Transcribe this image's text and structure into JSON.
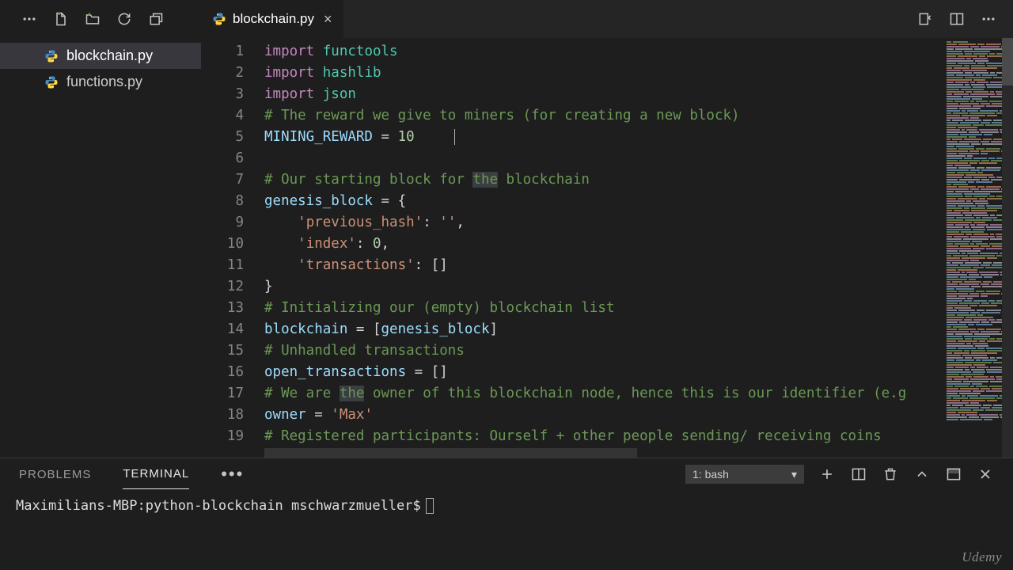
{
  "tab": {
    "filename": "blockchain.py"
  },
  "sidebar": {
    "files": [
      {
        "name": "blockchain.py",
        "active": true
      },
      {
        "name": "functions.py",
        "active": false
      }
    ]
  },
  "editor": {
    "lines": [
      {
        "n": 1,
        "tokens": [
          [
            "kw",
            "import"
          ],
          [
            "w",
            " "
          ],
          [
            "mod",
            "functools"
          ]
        ]
      },
      {
        "n": 2,
        "tokens": [
          [
            "kw",
            "import"
          ],
          [
            "w",
            " "
          ],
          [
            "mod",
            "hashlib"
          ]
        ]
      },
      {
        "n": 3,
        "tokens": [
          [
            "kw",
            "import"
          ],
          [
            "w",
            " "
          ],
          [
            "mod",
            "json"
          ]
        ]
      },
      {
        "n": 4,
        "tokens": [
          [
            "com",
            "# The reward we give to miners (for creating a new block)"
          ]
        ]
      },
      {
        "n": 5,
        "tokens": [
          [
            "var",
            "MINING_REWARD"
          ],
          [
            "w",
            " = "
          ],
          [
            "num",
            "10"
          ]
        ],
        "caret": true
      },
      {
        "n": 6,
        "tokens": []
      },
      {
        "n": 7,
        "tokens": [
          [
            "com",
            "# Our starting block for "
          ],
          [
            "comhl",
            "the"
          ],
          [
            "com",
            " blockchain"
          ]
        ]
      },
      {
        "n": 8,
        "tokens": [
          [
            "var",
            "genesis_block"
          ],
          [
            "w",
            " = {"
          ]
        ]
      },
      {
        "n": 9,
        "tokens": [
          [
            "w",
            "    "
          ],
          [
            "str",
            "'previous_hash'"
          ],
          [
            "w",
            ": "
          ],
          [
            "str",
            "''"
          ],
          [
            "w",
            ","
          ]
        ]
      },
      {
        "n": 10,
        "tokens": [
          [
            "w",
            "    "
          ],
          [
            "str",
            "'index'"
          ],
          [
            "w",
            ": "
          ],
          [
            "num",
            "0"
          ],
          [
            "w",
            ","
          ]
        ]
      },
      {
        "n": 11,
        "tokens": [
          [
            "w",
            "    "
          ],
          [
            "str",
            "'transactions'"
          ],
          [
            "w",
            ": []"
          ]
        ]
      },
      {
        "n": 12,
        "tokens": [
          [
            "w",
            "}"
          ]
        ]
      },
      {
        "n": 13,
        "tokens": [
          [
            "com",
            "# Initializing our (empty) blockchain list"
          ]
        ]
      },
      {
        "n": 14,
        "tokens": [
          [
            "var",
            "blockchain"
          ],
          [
            "w",
            " = ["
          ],
          [
            "var",
            "genesis_block"
          ],
          [
            "w",
            "]"
          ]
        ]
      },
      {
        "n": 15,
        "tokens": [
          [
            "com",
            "# Unhandled transactions"
          ]
        ]
      },
      {
        "n": 16,
        "tokens": [
          [
            "var",
            "open_transactions"
          ],
          [
            "w",
            " = []"
          ]
        ]
      },
      {
        "n": 17,
        "tokens": [
          [
            "com",
            "# We are "
          ],
          [
            "comhl",
            "the"
          ],
          [
            "com",
            " owner of this blockchain node, hence this is our identifier (e.g"
          ]
        ]
      },
      {
        "n": 18,
        "tokens": [
          [
            "var",
            "owner"
          ],
          [
            "w",
            " = "
          ],
          [
            "str",
            "'Max'"
          ]
        ]
      },
      {
        "n": 19,
        "tokens": [
          [
            "com",
            "# Registered participants: Ourself + other people sending/ receiving coins"
          ]
        ]
      }
    ]
  },
  "panel": {
    "tabs": {
      "problems": "PROBLEMS",
      "terminal": "TERMINAL"
    },
    "terminal_select": "1: bash",
    "prompt": "Maximilians-MBP:python-blockchain mschwarzmueller$"
  },
  "watermark": "Udemy"
}
